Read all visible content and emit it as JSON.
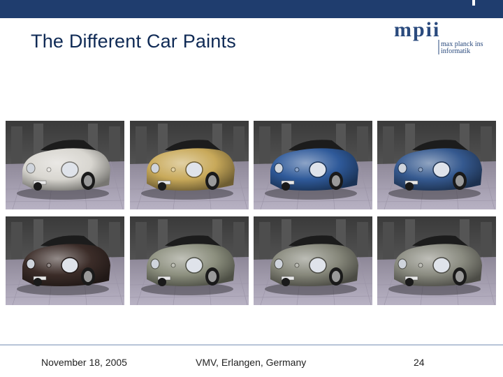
{
  "slide": {
    "title": "The Different Car Paints"
  },
  "logo": {
    "mark": "mpii",
    "line1": "max planck institut",
    "line2": "informatik",
    "color": "#2a4a7d"
  },
  "renders": [
    {
      "paint": "white",
      "color": "#d8d6d0"
    },
    {
      "paint": "gold",
      "color": "#c8a95a"
    },
    {
      "paint": "blue",
      "color": "#2f5a9a"
    },
    {
      "paint": "blue",
      "color": "#35598f"
    },
    {
      "paint": "dark brown",
      "color": "#3b2c28"
    },
    {
      "paint": "gray metallic",
      "color": "#8c8f7e"
    },
    {
      "paint": "gray metallic",
      "color": "#86877a"
    },
    {
      "paint": "gray metallic",
      "color": "#8a8b80"
    }
  ],
  "footer": {
    "date": "November 18, 2005",
    "venue": "VMV, Erlangen, Germany",
    "page": "24"
  }
}
